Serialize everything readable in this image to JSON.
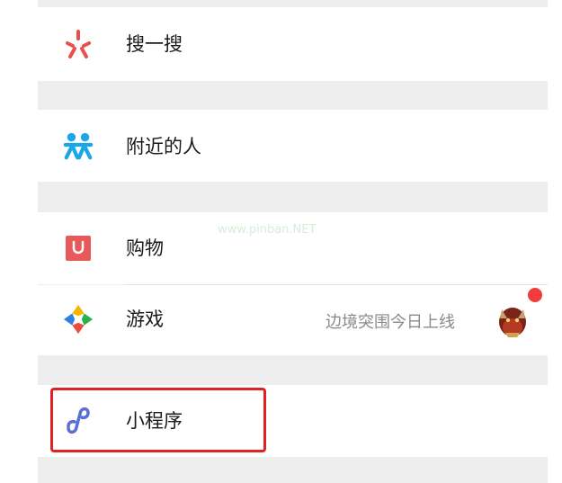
{
  "menu": {
    "items": [
      {
        "label": "搜一搜",
        "icon": "search-sparkle-icon"
      },
      {
        "label": "附近的人",
        "icon": "people-nearby-icon"
      },
      {
        "label": "购物",
        "icon": "shopping-bag-icon"
      },
      {
        "label": "游戏",
        "icon": "game-diamond-icon",
        "note": "边境突围今日上线"
      },
      {
        "label": "小程序",
        "icon": "mini-program-icon"
      }
    ]
  },
  "watermark": "www.pinban.NET",
  "colors": {
    "section_gap": "#ededed",
    "highlight": "#e02222",
    "badge": "#f03c3c",
    "search_icon": "#e9504c",
    "nearby_icon": "#1aa7e8",
    "shopping_icon": "#e85a5a",
    "mini_program_icon": "#5a6fd6"
  }
}
